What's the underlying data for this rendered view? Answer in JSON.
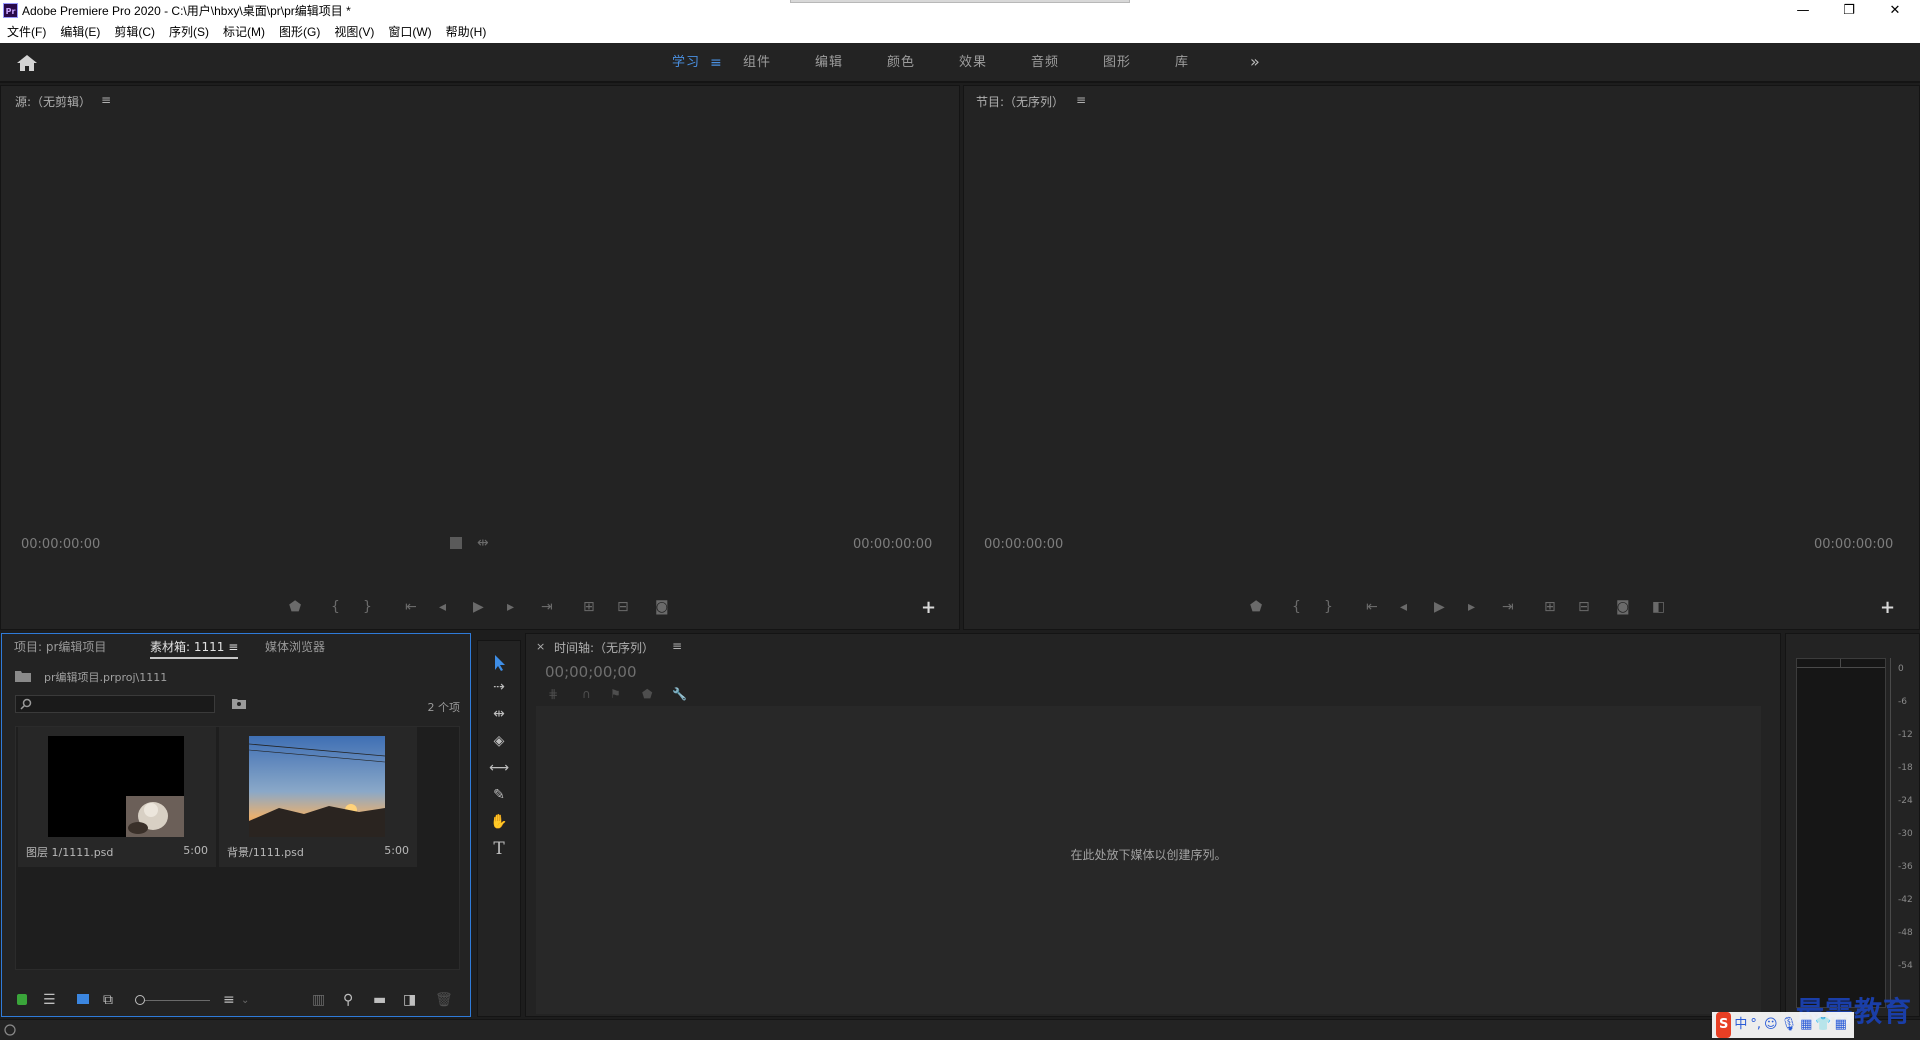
{
  "window": {
    "title": "Adobe Premiere Pro 2020 - C:\\用户\\hbxy\\桌面\\pr\\pr编辑项目 *",
    "app_icon_text": "Pr",
    "minimize": "—",
    "restore": "❐",
    "close": "✕"
  },
  "menubar": {
    "items": [
      "文件(F)",
      "编辑(E)",
      "剪辑(C)",
      "序列(S)",
      "标记(M)",
      "图形(G)",
      "视图(V)",
      "窗口(W)",
      "帮助(H)"
    ]
  },
  "workspaces": {
    "tabs": [
      "学习",
      "组件",
      "编辑",
      "颜色",
      "效果",
      "音频",
      "图形",
      "库"
    ],
    "active": "学习",
    "menu_glyph": "≡",
    "more_glyph": "»"
  },
  "source_monitor": {
    "title": "源:（无剪辑）",
    "menu_glyph": "≡",
    "timecode_left": "00:00:00:00",
    "timecode_right": "00:00:00:00"
  },
  "program_monitor": {
    "title": "节目:（无序列）",
    "menu_glyph": "≡",
    "timecode_left": "00:00:00:00",
    "timecode_right": "00:00:00:00"
  },
  "project_panel": {
    "tabs": [
      "项目: pr编辑项目",
      "素材箱: 1111",
      "媒体浏览器"
    ],
    "active_tab": "素材箱: 1111",
    "menu_glyph": "≡",
    "path": "pr编辑项目.prproj\\1111",
    "item_count": "2 个项",
    "clips": [
      {
        "name": "图层 1/1111.psd",
        "duration": "5:00"
      },
      {
        "name": "背景/1111.psd",
        "duration": "5:00"
      }
    ]
  },
  "timeline": {
    "close_glyph": "×",
    "title": "时间轴:（无序列）",
    "menu_glyph": "≡",
    "timecode": "00;00;00;00",
    "drop_hint": "在此处放下媒体以创建序列。"
  },
  "audio_meter": {
    "db_labels": [
      "0",
      "-6",
      "-12",
      "-18",
      "-24",
      "-30",
      "-36",
      "-42",
      "-48",
      "-54"
    ]
  },
  "watermark": {
    "text": "最需教育"
  },
  "ime": {
    "items": [
      "S",
      "中",
      "°,",
      "☺",
      "🎙",
      "▦",
      "👕",
      "▦"
    ]
  },
  "colors": {
    "accent": "#4a90e2",
    "panel_bg": "#232323",
    "border_focus": "#2f7bd9"
  }
}
